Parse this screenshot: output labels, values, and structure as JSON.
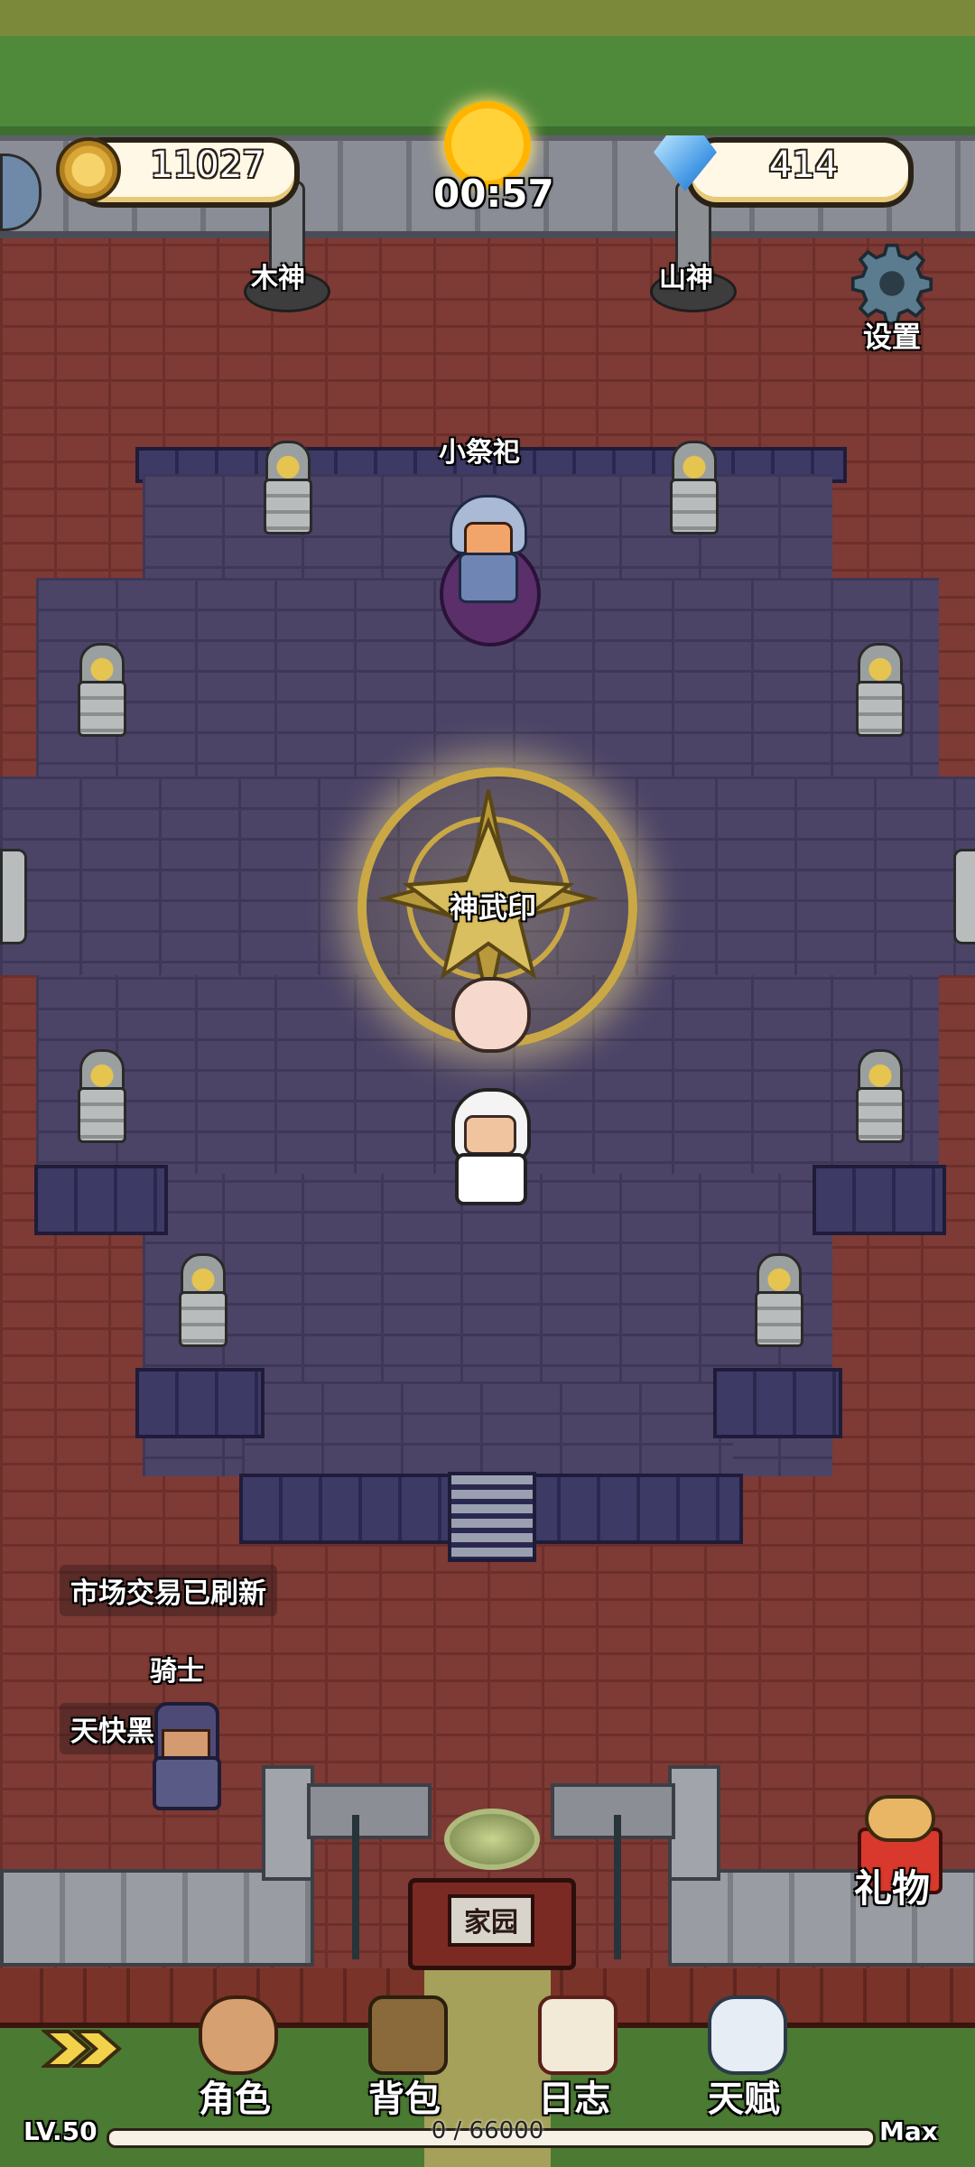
{
  "resources": {
    "coins": "11027",
    "gems": "414",
    "timer": "00:57"
  },
  "statues": {
    "left": "木神",
    "right": "山神"
  },
  "settings_label": "设置",
  "npc_name": "小祭祀",
  "seal_label": "神武印",
  "messages": {
    "market": "市场交易已刷新",
    "knight_name": "骑士",
    "dark": "天快黑了"
  },
  "home_sign": "家园",
  "gift_label": "礼物",
  "menu": [
    {
      "label": "角色",
      "icon": "character-icon"
    },
    {
      "label": "背包",
      "icon": "backpack-icon"
    },
    {
      "label": "日志",
      "icon": "journal-icon"
    },
    {
      "label": "天赋",
      "icon": "talent-icon"
    }
  ],
  "xp": {
    "level": "LV.50",
    "progress": "0 / 66000",
    "max": "Max",
    "fraction": 0.0
  },
  "colors": {
    "floor": "#4c4467",
    "brick": "#7e3a35",
    "gold": "#c9a845",
    "grass": "#4f8a3b"
  }
}
